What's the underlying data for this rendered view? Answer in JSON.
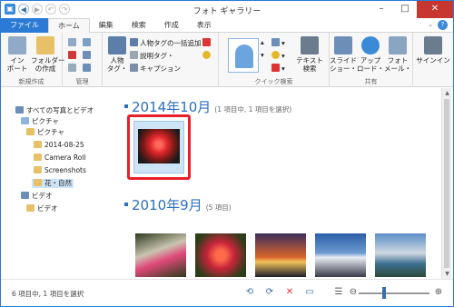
{
  "window": {
    "title": "フォト ギャラリー"
  },
  "quick_access": {
    "icons": [
      "app-icon",
      "back-icon",
      "forward-icon",
      "undo-icon",
      "redo-icon"
    ]
  },
  "tabs": [
    {
      "label": "ファイル"
    },
    {
      "label": "ホーム"
    },
    {
      "label": "編集"
    },
    {
      "label": "検索"
    },
    {
      "label": "作成"
    },
    {
      "label": "表示"
    }
  ],
  "ribbon": {
    "new": {
      "import_label": "イン\nポート",
      "folder_label": "フォルダー\nの作成",
      "group_label": "新規作成"
    },
    "manage": {
      "group_label": "管理"
    },
    "organize": {
      "people_tag_label": "人物\nタグ・",
      "batch_people_label": "人物タグの一括追加",
      "caption_tag_label": "説明タグ・",
      "caption_label": "キャプション"
    },
    "quick_find": {
      "text_search_label": "テキスト\n検索",
      "group_label": "クイック検索"
    },
    "share": {
      "slideshow_label": "スライド\nショー・",
      "upload_label": "アップ\nロード・",
      "photo_mail_label": "フォト\nメール・",
      "group_label": "共有"
    },
    "signin": {
      "label": "サインイン"
    }
  },
  "tree": {
    "root": "すべての写真とビデオ",
    "pictures": "ピクチャ",
    "pictures_sub": "ピクチャ",
    "folders": [
      "2014-08-25",
      "Camera Roll",
      "Screenshots",
      "花・自然"
    ],
    "videos": "ビデオ",
    "videos_sub": "ビデオ"
  },
  "groups": [
    {
      "title": "2014年10月",
      "subtitle": "(1 項目中, 1 項目を選択)"
    },
    {
      "title": "2010年9月",
      "subtitle": "(5 項目)"
    }
  ],
  "status": {
    "text": "6 項目中, 1 項目を選択"
  },
  "colors": {
    "accent": "#2b7bd6",
    "selection": "#e8202a",
    "heading": "#2b6fbf"
  }
}
